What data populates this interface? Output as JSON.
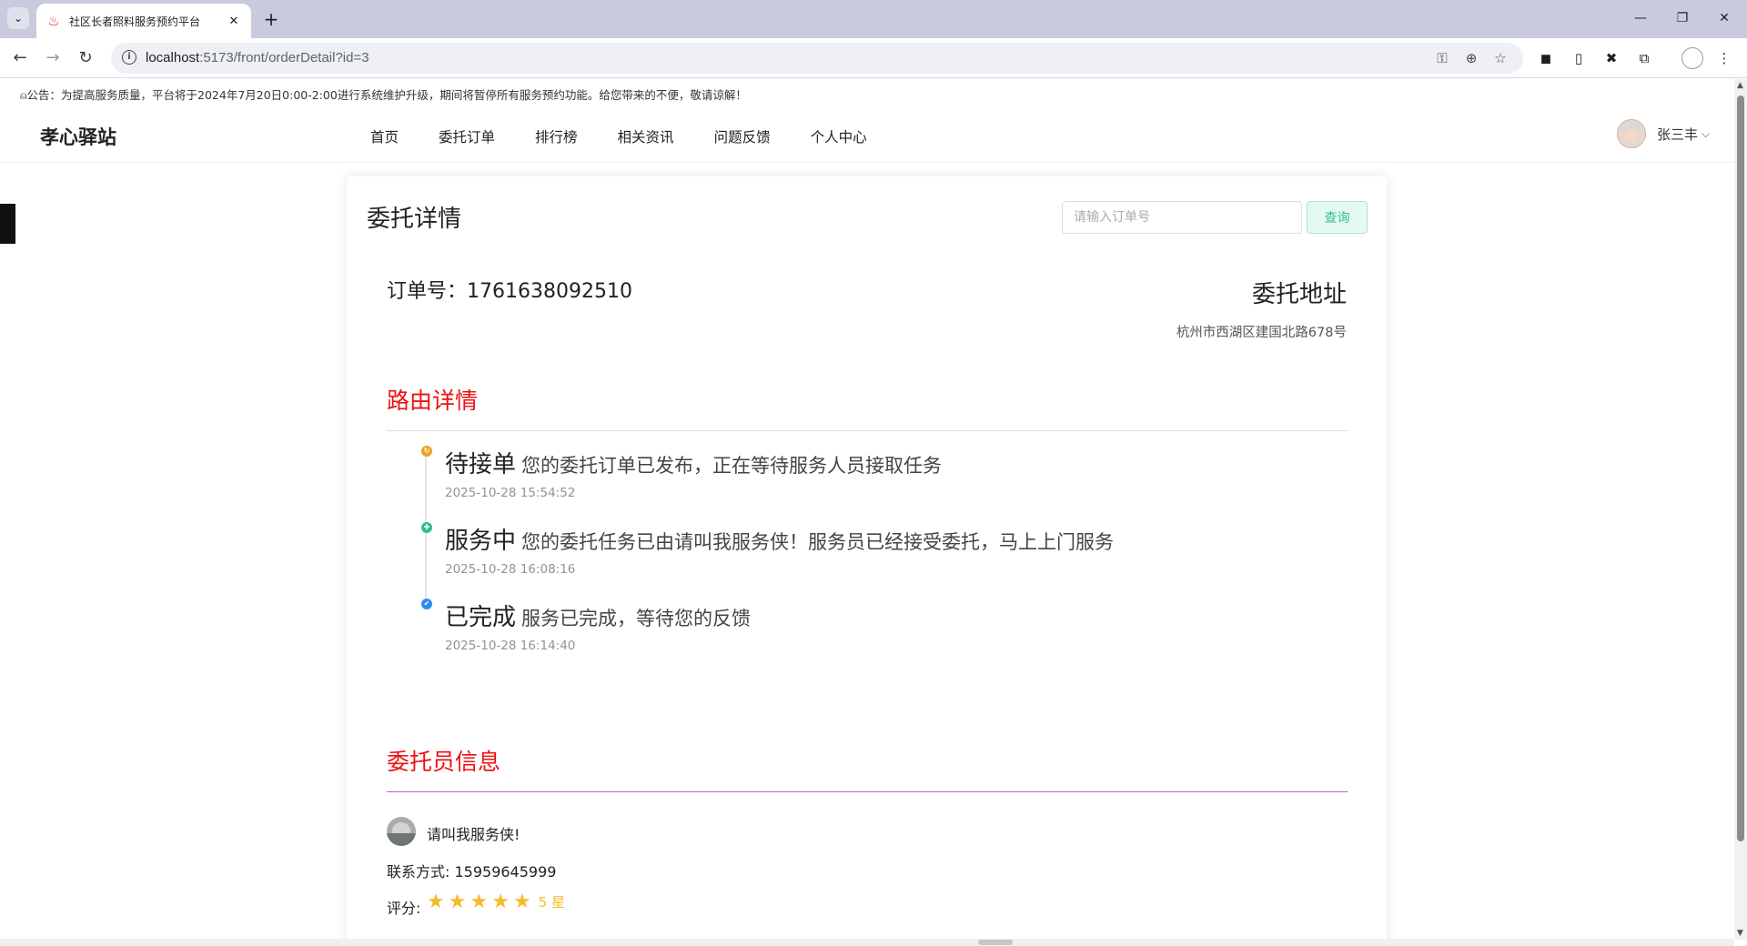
{
  "browser": {
    "tab_title": "社区长者照料服务预约平台",
    "url_host": "localhost",
    "url_rest": ":5173/front/orderDetail?id=3"
  },
  "notice": "公告：为提高服务质量，平台将于2024年7月20日0:00-2:00进行系统维护升级，期间将暂停所有服务预约功能。给您带来的不便，敬请谅解！",
  "header": {
    "logo": "孝心驿站",
    "nav": [
      "首页",
      "委托订单",
      "排行榜",
      "相关资讯",
      "问题反馈",
      "个人中心"
    ],
    "user_name": "张三丰"
  },
  "card": {
    "title": "委托详情",
    "search_placeholder": "请输入订单号",
    "search_button": "查询",
    "order_no": "订单号：1761638092510",
    "address_title": "委托地址",
    "address": "杭州市西湖区建国北路678号",
    "route_title": "路由详情",
    "timeline": [
      {
        "status": "待接单",
        "desc": "您的委托订单已发布，正在等待服务人员接取任务",
        "time": "2025-10-28 15:54:52",
        "color": "#f0a020"
      },
      {
        "status": "服务中",
        "desc": "您的委托任务已由请叫我服务侠！服务员已经接受委托，马上上门服务",
        "time": "2025-10-28 16:08:16",
        "color": "#2fbf8b"
      },
      {
        "status": "已完成",
        "desc": "服务已完成，等待您的反馈",
        "time": "2025-10-28 16:14:40",
        "color": "#2d8cf0"
      }
    ],
    "employee_title": "委托员信息",
    "employee_name": "请叫我服务侠!",
    "contact": "联系方式: 15959645999",
    "rating_label": "评分:",
    "rating_value": 5,
    "rating_text": "5 星"
  }
}
